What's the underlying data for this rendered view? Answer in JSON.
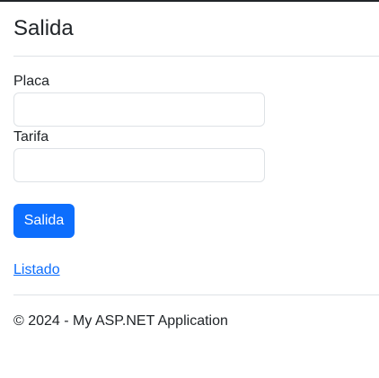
{
  "page": {
    "title": "Salida"
  },
  "form": {
    "placa_label": "Placa",
    "placa_value": "",
    "tarifa_label": "Tarifa",
    "tarifa_value": "",
    "submit_label": "Salida"
  },
  "links": {
    "listado": "Listado"
  },
  "footer": {
    "text": "© 2024 - My ASP.NET Application"
  },
  "colors": {
    "primary": "#0d6efd",
    "text": "#212529",
    "border": "#dee2e6"
  }
}
